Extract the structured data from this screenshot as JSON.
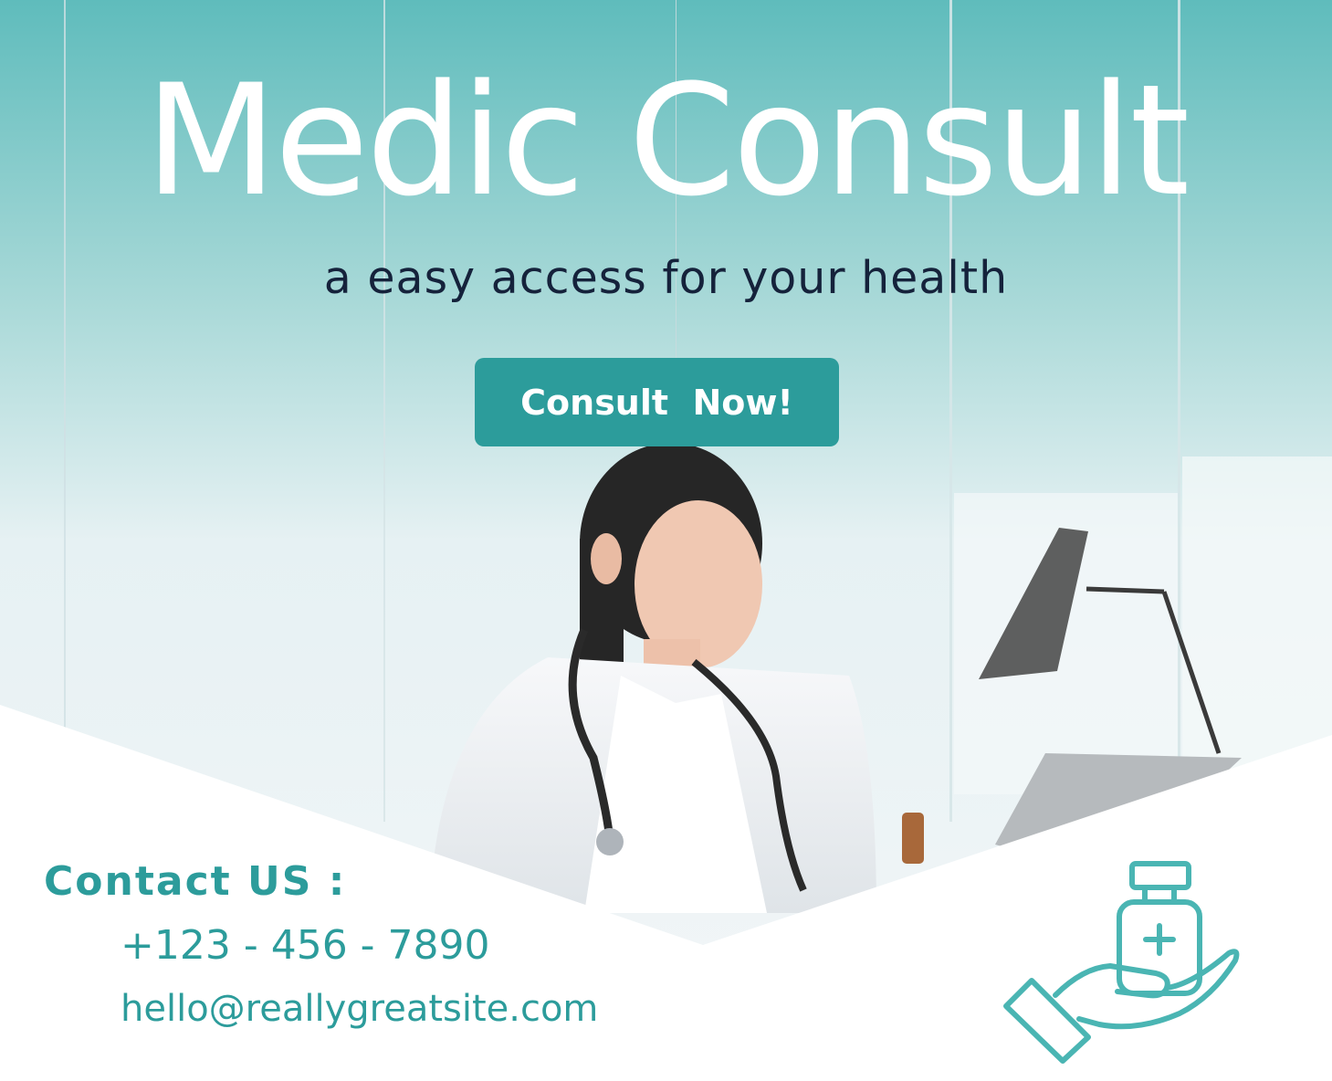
{
  "hero": {
    "title": "Medic Consult",
    "tagline": "a easy access for your health",
    "cta_label": "Consult  Now!"
  },
  "contact": {
    "heading": "Contact US :",
    "phone": "+123 - 456 - 7890",
    "email": "hello@reallygreatsite.com"
  },
  "icons": {
    "hero_image": "doctor-at-desk-photo",
    "medicine": "hand-holding-medicine-icon"
  },
  "colors": {
    "accent": "#2c9c9b",
    "heading_text": "#15223b",
    "top_tint": "#5fbcbc",
    "white": "#ffffff"
  }
}
